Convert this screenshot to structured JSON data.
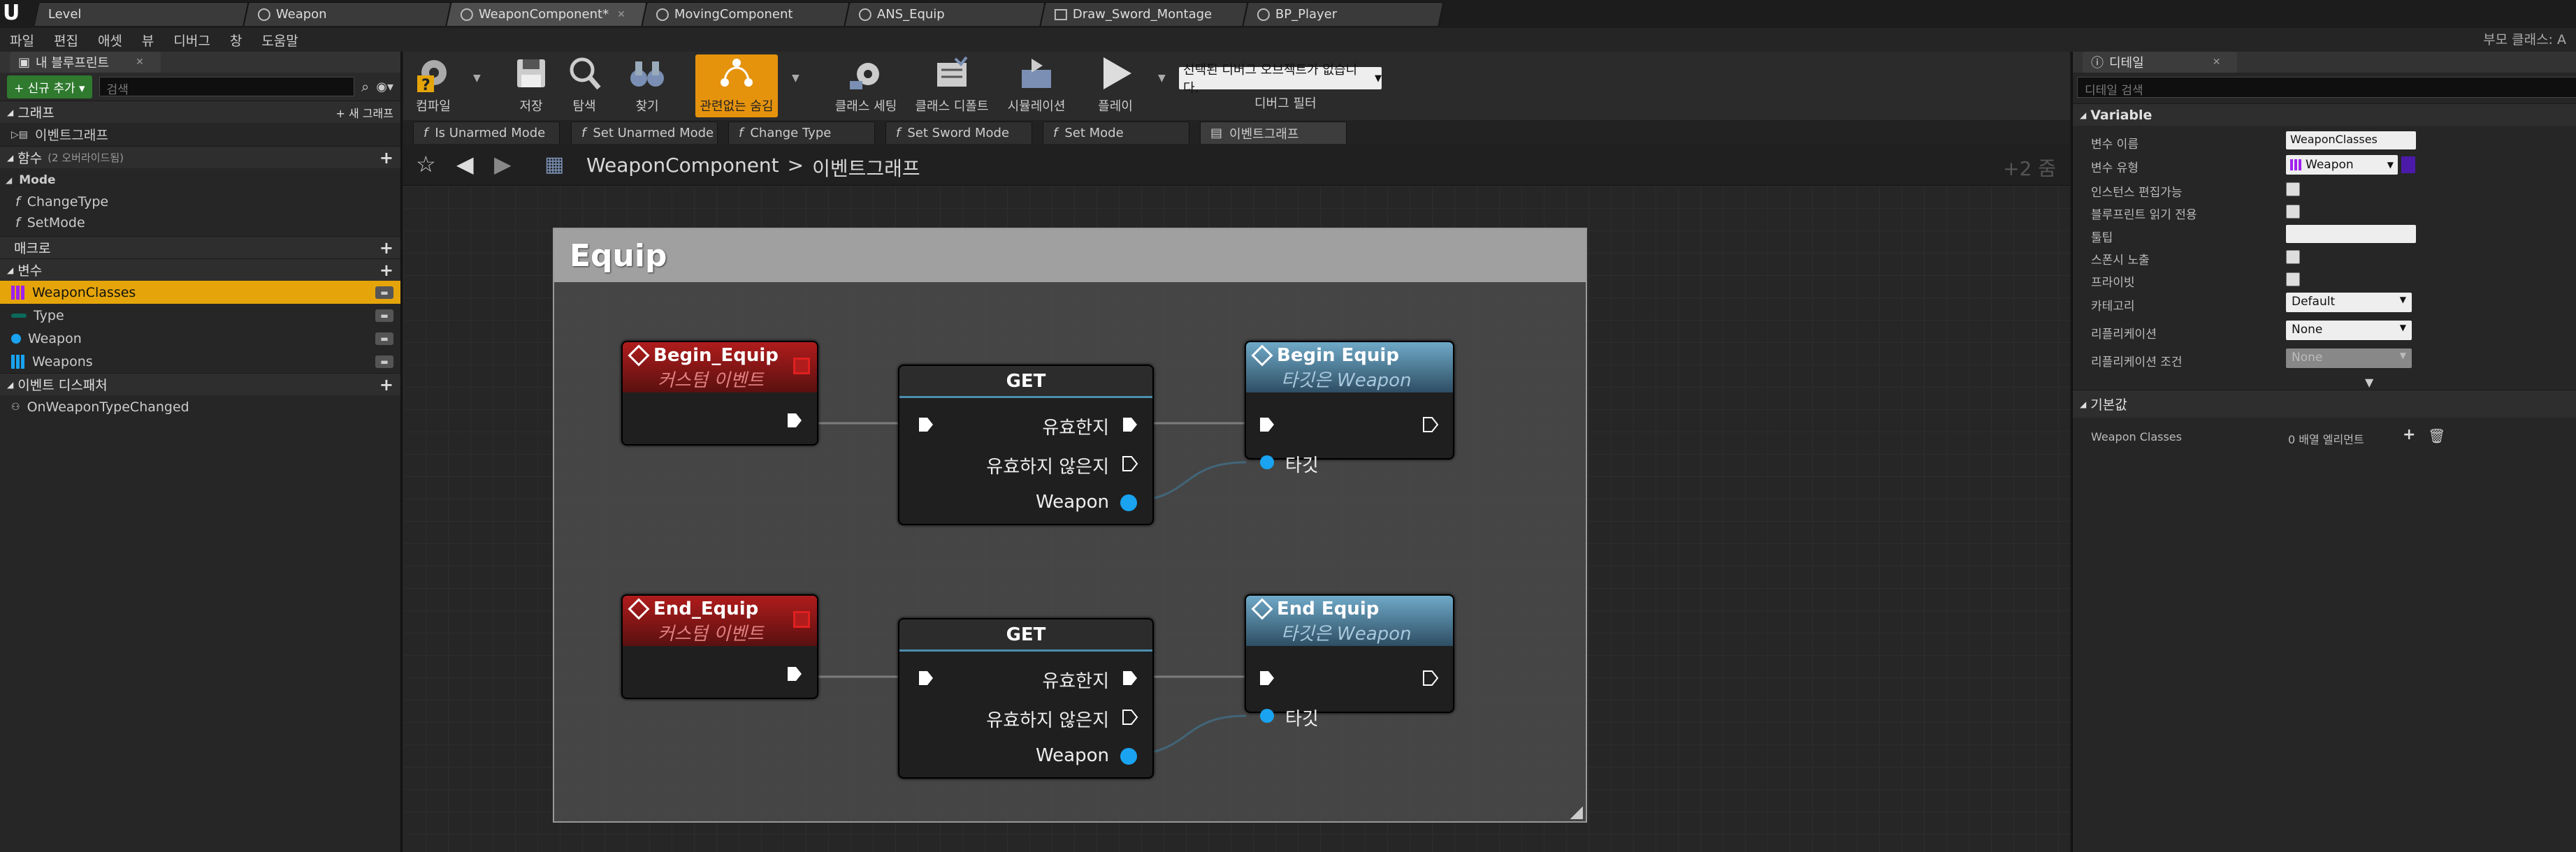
{
  "tabs": [
    "Level",
    "Weapon",
    "WeaponComponent*",
    "MovingComponent",
    "ANS_Equip",
    "Draw_Sword_Montage",
    "BP_Player"
  ],
  "top_right": "부모 클래스: A",
  "menu": [
    "파일",
    "편집",
    "애셋",
    "뷰",
    "디버그",
    "창",
    "도움말"
  ],
  "left": {
    "panel_title": "내 블루프린트",
    "add_new": "+ 신규 추가 ▾",
    "search_placeholder": "검색",
    "graph_header": "그래프",
    "new_graph": "+ 새 그래프",
    "event_graph": "이벤트그래프",
    "functions_header": "함수",
    "functions_override": "(2 오버라이드됨)",
    "mode_category": "Mode",
    "functions": [
      "ChangeType",
      "SetMode"
    ],
    "macros_header": "매크로",
    "variables_header": "변수",
    "variables": [
      "WeaponClasses",
      "Type",
      "Weapon",
      "Weapons"
    ],
    "dispatchers_header": "이벤트 디스패처",
    "dispatchers": [
      "OnWeaponTypeChanged"
    ]
  },
  "toolbar": {
    "compile": "컴파일",
    "save": "저장",
    "browse": "탐색",
    "find": "찾기",
    "hide_pins": "관련없는 숨김",
    "class_settings": "클래스 세팅",
    "class_defaults": "클래스 디폴트",
    "simulation": "시뮬레이션",
    "play": "플레이",
    "debug_select": "선택된 디버그 오브젝트가 없습니다.",
    "debug_filter": "디버그 필터"
  },
  "func_tabs": [
    "Is Unarmed Mode",
    "Set Unarmed Mode",
    "Change Type",
    "Set Sword Mode",
    "Set Mode",
    "이벤트그래프"
  ],
  "breadcrumb": {
    "component": "WeaponComponent",
    "sep": ">",
    "graph": "이벤트그래프"
  },
  "zoom": "+2 줌",
  "graph": {
    "comment": "Equip",
    "begin_event": {
      "title": "Begin_Equip",
      "sub": "커스텀 이벤트"
    },
    "end_event": {
      "title": "End_Equip",
      "sub": "커스텀 이벤트"
    },
    "get_title": "GET",
    "valid": "유효한지",
    "invalid": "유효하지 않은지",
    "weapon": "Weapon",
    "begin_call": {
      "title": "Begin Equip",
      "sub": "타깃은 Weapon"
    },
    "end_call": {
      "title": "End Equip",
      "sub": "타깃은 Weapon"
    },
    "target": "타깃"
  },
  "details": {
    "tab": "디테일",
    "search_placeholder": "디테일 검색",
    "variable_section": "Variable",
    "labels": [
      "변수 이름",
      "변수 유형",
      "인스턴스 편집가능",
      "블루프린트 읽기 전용",
      "툴팁",
      "스폰시 노출",
      "프라이빗",
      "카테고리",
      "리플리케이션",
      "리플리케이션 조건"
    ],
    "var_name": "WeaponClasses",
    "var_type": "Weapon",
    "category": "Default",
    "replication": "None",
    "replication_condition": "None",
    "default_section": "기본값",
    "default_name": "Weapon Classes",
    "default_value": "0 배열 엘리먼트"
  },
  "colors": {
    "accent": "#e5a50a",
    "event_red": "#b01c1c",
    "exec_white": "#ffffff",
    "object_pin": "#1aa3f0"
  }
}
